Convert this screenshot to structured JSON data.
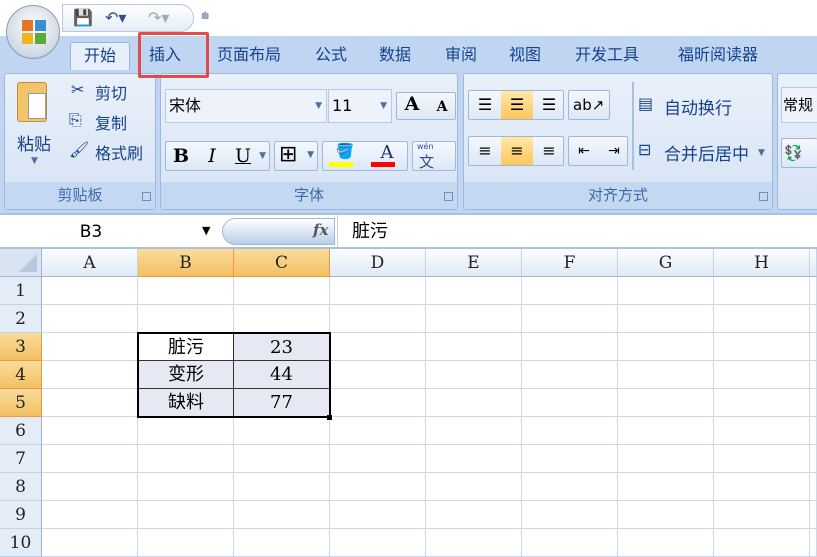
{
  "quick_access": {
    "save": "save-icon",
    "undo": "undo-icon",
    "redo": "redo-icon",
    "customize": "customize-icon"
  },
  "tabs": [
    "开始",
    "插入",
    "页面布局",
    "公式",
    "数据",
    "审阅",
    "视图",
    "开发工具",
    "福昕阅读器"
  ],
  "active_tab": "开始",
  "highlighted_tab": "插入",
  "highlight_color": "#e24b4b",
  "clipboard": {
    "paste": "粘贴",
    "cut": "剪切",
    "copy": "复制",
    "format_painter": "格式刷",
    "label": "剪贴板"
  },
  "font": {
    "name": "宋体",
    "size": "11",
    "grow": "A",
    "shrink": "A",
    "bold": "B",
    "italic": "I",
    "underline": "U",
    "color_letter": "A",
    "phonetic": "wén",
    "phonetic_char": "文",
    "label": "字体",
    "fill_color": "#ffff00",
    "font_color": "#ff0000"
  },
  "alignment": {
    "wrap_text": "自动换行",
    "merge_center": "合并后居中",
    "label": "对齐方式"
  },
  "number": {
    "format": "常规"
  },
  "formula_bar": {
    "name_box": "B3",
    "fx": "fx",
    "content": "脏污"
  },
  "columns": [
    "A",
    "B",
    "C",
    "D",
    "E",
    "F",
    "G",
    "H"
  ],
  "selected_columns": [
    "B",
    "C"
  ],
  "rows": [
    "1",
    "2",
    "3",
    "4",
    "5",
    "6",
    "7",
    "8",
    "9",
    "10"
  ],
  "selected_rows": [
    "3",
    "4",
    "5"
  ],
  "table": [
    [
      "脏污",
      "23"
    ],
    [
      "变形",
      "44"
    ],
    [
      "缺料",
      "77"
    ]
  ]
}
